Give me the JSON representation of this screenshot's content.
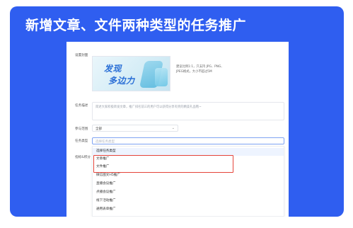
{
  "headline": "新增文章、文件两种类型的任务推广",
  "form": {
    "cover_label": "设置封面",
    "cover_image_text": [
      "发现",
      "多边力"
    ],
    "cover_hint": "建议比例1:1，只支持 JPG、PNG、JPEG格式，大小不超过5M",
    "desc_label": "任务描述",
    "desc_placeholder": "简述大家积极转发文章，推广排名前三的用户可以获得分享有奖的精美礼品哦~",
    "scope_label": "参与范围",
    "scope_value": "全部",
    "type_label": "任务类型",
    "type_placeholder": "选择任务类型",
    "target_label": "指标&积分"
  },
  "dropdown": {
    "options": [
      "选择任务类型",
      "文章推广",
      "文件推广",
      "微信图文H5推广",
      "直播会议推广",
      "点播会议推广",
      "线下活动推广",
      "通用表单推广"
    ],
    "highlighted": [
      "文章推广",
      "文件推广"
    ]
  },
  "colors": {
    "frame_bg": "#2f5ef0",
    "highlight_border": "#e5443a",
    "selected_option_bg": "#eef4ff"
  }
}
